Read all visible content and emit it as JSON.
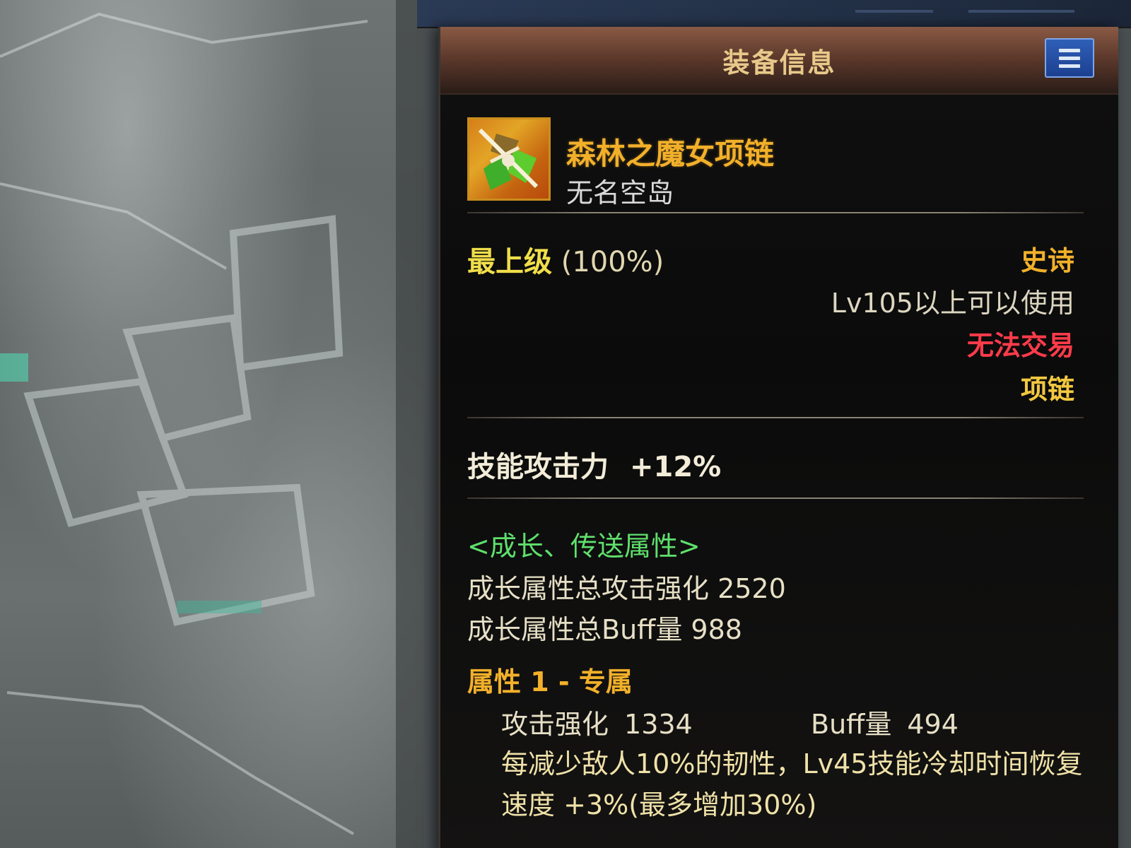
{
  "window": {
    "title": "装备信息"
  },
  "item": {
    "name": "森林之魔女项链",
    "source": "无名空岛",
    "icon": "necklace-item-icon"
  },
  "quality": {
    "grade": "最上级",
    "percent": "(100%)"
  },
  "properties": {
    "rarity": "史诗",
    "level_requirement": "Lv105以上可以使用",
    "trade": "无法交易",
    "slot": "项链"
  },
  "main_stat": {
    "label": "技能攻击力",
    "value": "+12%"
  },
  "growth": {
    "header": "<成长、传送属性>",
    "total_attack": "成长属性总攻击强化 2520",
    "total_buff": "成长属性总Buff量 988"
  },
  "attribute_1": {
    "title": "属性 1 - 专属",
    "attack_label": "攻击强化",
    "attack_value": "1334",
    "buff_label": "Buff量",
    "buff_value": "494",
    "description": "每减少敌人10%的韧性，Lv45技能冷却时间恢复速度 +3%(最多增加30%)"
  },
  "colors": {
    "title_bar": "#5e3a2c",
    "item_name": "#f2b02a",
    "rarity_epic": "#f2b02a",
    "untradable": "#ff3b4a",
    "growth_header": "#5fe06c",
    "menu_button": "#2f5fb8"
  }
}
